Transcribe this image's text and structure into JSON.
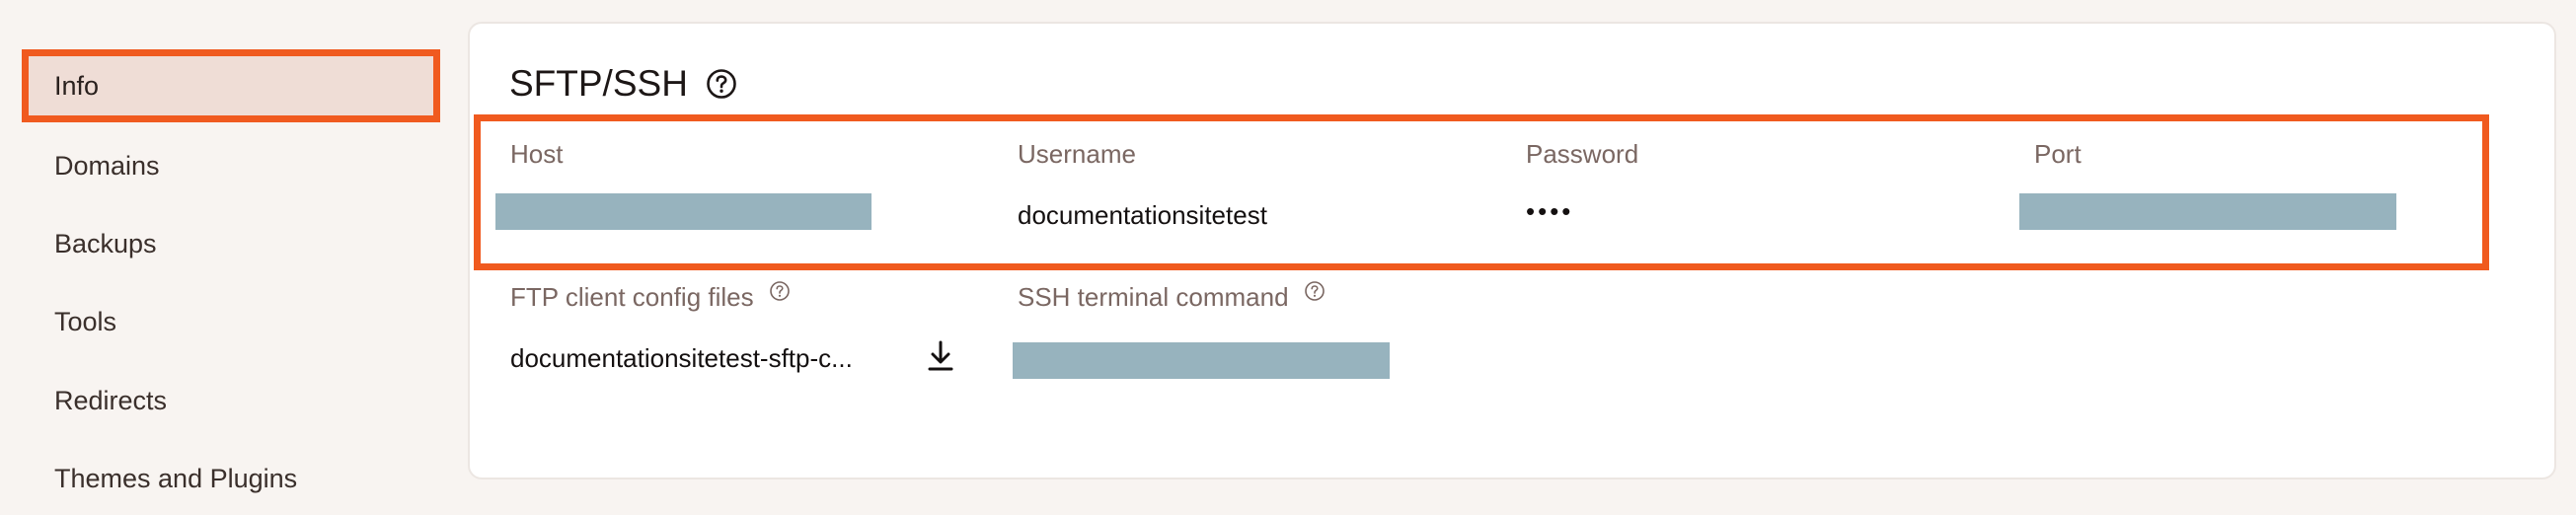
{
  "sidebar": {
    "items": [
      {
        "label": "Info",
        "active": true
      },
      {
        "label": "Domains",
        "active": false
      },
      {
        "label": "Backups",
        "active": false
      },
      {
        "label": "Tools",
        "active": false
      },
      {
        "label": "Redirects",
        "active": false
      },
      {
        "label": "Themes and Plugins",
        "active": false
      }
    ]
  },
  "sftp": {
    "title": "SFTP/SSH",
    "title_icon": "help-circle-icon",
    "columns": {
      "host": {
        "label": "Host",
        "value": ""
      },
      "username": {
        "label": "Username",
        "value": "documentationsitetest"
      },
      "password": {
        "label": "Password",
        "value": "••••"
      },
      "port": {
        "label": "Port",
        "value": ""
      }
    },
    "ftp_config": {
      "label": "FTP client config files",
      "value": "documentationsitetest-sftp-c...",
      "icon": "download-icon"
    },
    "ssh_command": {
      "label": "SSH terminal command",
      "value": ""
    }
  },
  "colors": {
    "highlight": "#f05a1f",
    "redacted": "#97b3be",
    "active_bg": "#efddd6",
    "background": "#f8f4f1"
  }
}
